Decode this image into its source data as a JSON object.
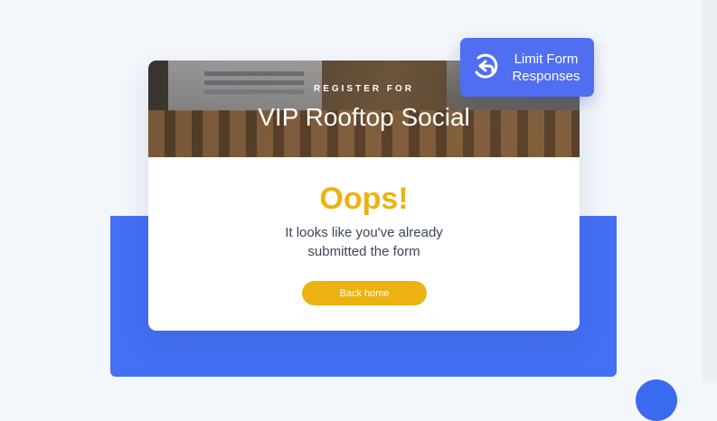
{
  "hero": {
    "eyebrow": "REGISTER FOR",
    "title": "VIP Rooftop Social"
  },
  "message": {
    "heading": "Oops!",
    "line1": "It looks like you've already",
    "line2": "submitted the form"
  },
  "actions": {
    "back_home_label": "Back home"
  },
  "badge": {
    "line1": "Limit Form",
    "line2": "Responses",
    "icon": "undo-arrow-icon"
  },
  "colors": {
    "accent_yellow": "#ecb212",
    "brand_blue": "#4470f5",
    "badge_blue": "#4f6ef2",
    "text_dark": "#3a4556"
  }
}
